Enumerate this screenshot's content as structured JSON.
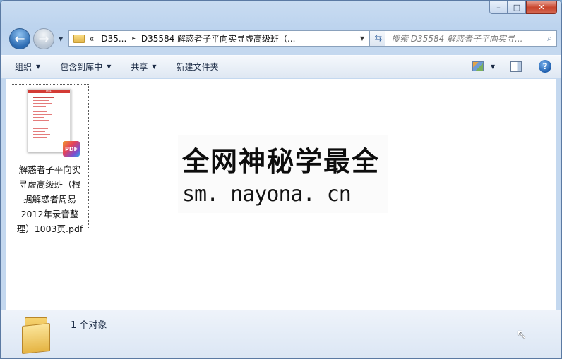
{
  "window": {
    "caption": {
      "minimize": "–",
      "maximize": "□",
      "close": "✕"
    }
  },
  "nav": {
    "back_icon": "←",
    "forward_icon": "→",
    "history_dropdown": "▼",
    "address": {
      "overflow": "«",
      "crumb1": "D35...",
      "separator": "▸",
      "crumb2": "D35584 解惑者子平向实寻虚高级班（...",
      "dropdown": "▼"
    },
    "refresh_icon": "⇆",
    "search_placeholder": "搜索 D35584 解惑者子平向实寻...",
    "search_icon": "⌕"
  },
  "toolbar": {
    "organize": "组织",
    "include_library": "包含到库中",
    "share": "共享",
    "new_folder": "新建文件夹",
    "caret": "▼",
    "help": "?"
  },
  "files": [
    {
      "name_lines": [
        "解惑者子平向实",
        "寻虚高级班（根",
        "据解惑者周易",
        "2012年录音整",
        "理）1003页.pdf"
      ],
      "badge": "PDF",
      "thumb_header": "PDF"
    }
  ],
  "watermark": {
    "title": "全网神秘学最全",
    "url": "sm. nayona. cn"
  },
  "details": {
    "count": "1 个对象"
  },
  "icons": {
    "folder": "folder-icon",
    "pdf": "pdf-file-icon",
    "views": "views-icon",
    "preview_pane": "preview-pane-icon",
    "help": "help-icon"
  }
}
